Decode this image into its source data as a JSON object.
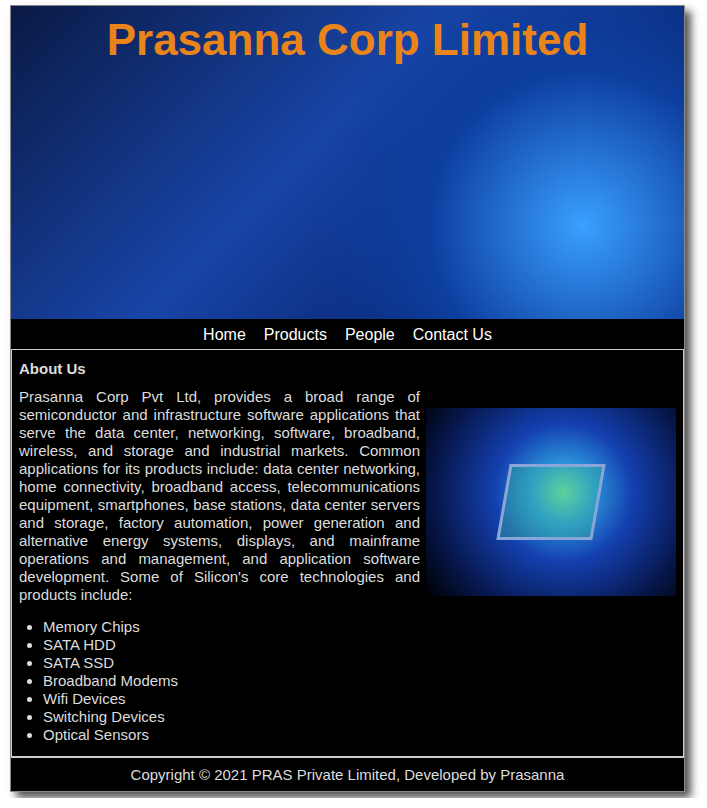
{
  "header": {
    "title": "Prasanna Corp Limited"
  },
  "nav": {
    "items": [
      {
        "label": "Home"
      },
      {
        "label": "Products"
      },
      {
        "label": "People"
      },
      {
        "label": "Contact Us"
      }
    ]
  },
  "about": {
    "heading": "About Us",
    "paragraph": "Prasanna Corp Pvt Ltd, provides a broad range of semiconductor and infrastructure software applications that serve the data center, networking, software, broadband, wireless, and storage and industrial markets. Common applications for its products include: data center networking, home connectivity, broadband access, telecommunications equipment, smartphones, base stations, data center servers and storage, factory automation, power generation and alternative energy systems, displays, and mainframe operations and management, and application software development. Some of Silicon's core technologies and products include:",
    "products": [
      "Memory Chips",
      "SATA HDD",
      "SATA SSD",
      "Broadband Modems",
      "Wifi Devices",
      "Switching Devices",
      "Optical Sensors"
    ]
  },
  "footer": {
    "text": "Copyright © 2021 PRAS Private Limited, Developed by Prasanna"
  }
}
